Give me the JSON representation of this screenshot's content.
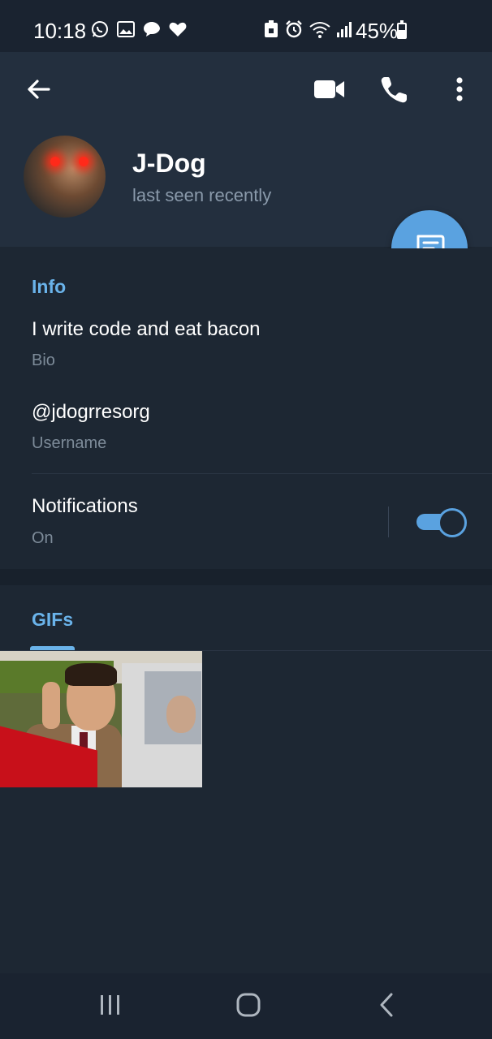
{
  "status_bar": {
    "time": "10:18",
    "battery": "45%",
    "left_icons": [
      "whatsapp-icon",
      "gallery-icon",
      "chat-bubble-icon",
      "heart-icon"
    ],
    "right_icons": [
      "lock-battery-icon",
      "alarm-icon",
      "wifi-icon",
      "signal-icon"
    ]
  },
  "header": {
    "name": "J-Dog",
    "status": "last seen recently",
    "actions": [
      "back-arrow-icon",
      "video-call-icon",
      "phone-icon",
      "more-vertical-icon"
    ]
  },
  "info": {
    "title": "Info",
    "bio_value": "I write code and eat bacon",
    "bio_label": "Bio",
    "username_value": "@jdogrresorg",
    "username_label": "Username",
    "notifications_label": "Notifications",
    "notifications_state": "On",
    "notifications_enabled": true
  },
  "media": {
    "tab_label": "GIFs"
  },
  "colors": {
    "accent": "#5aa2e0",
    "section_title": "#6ab3ea",
    "background": "#1d2733",
    "header_background": "#232f3e"
  }
}
